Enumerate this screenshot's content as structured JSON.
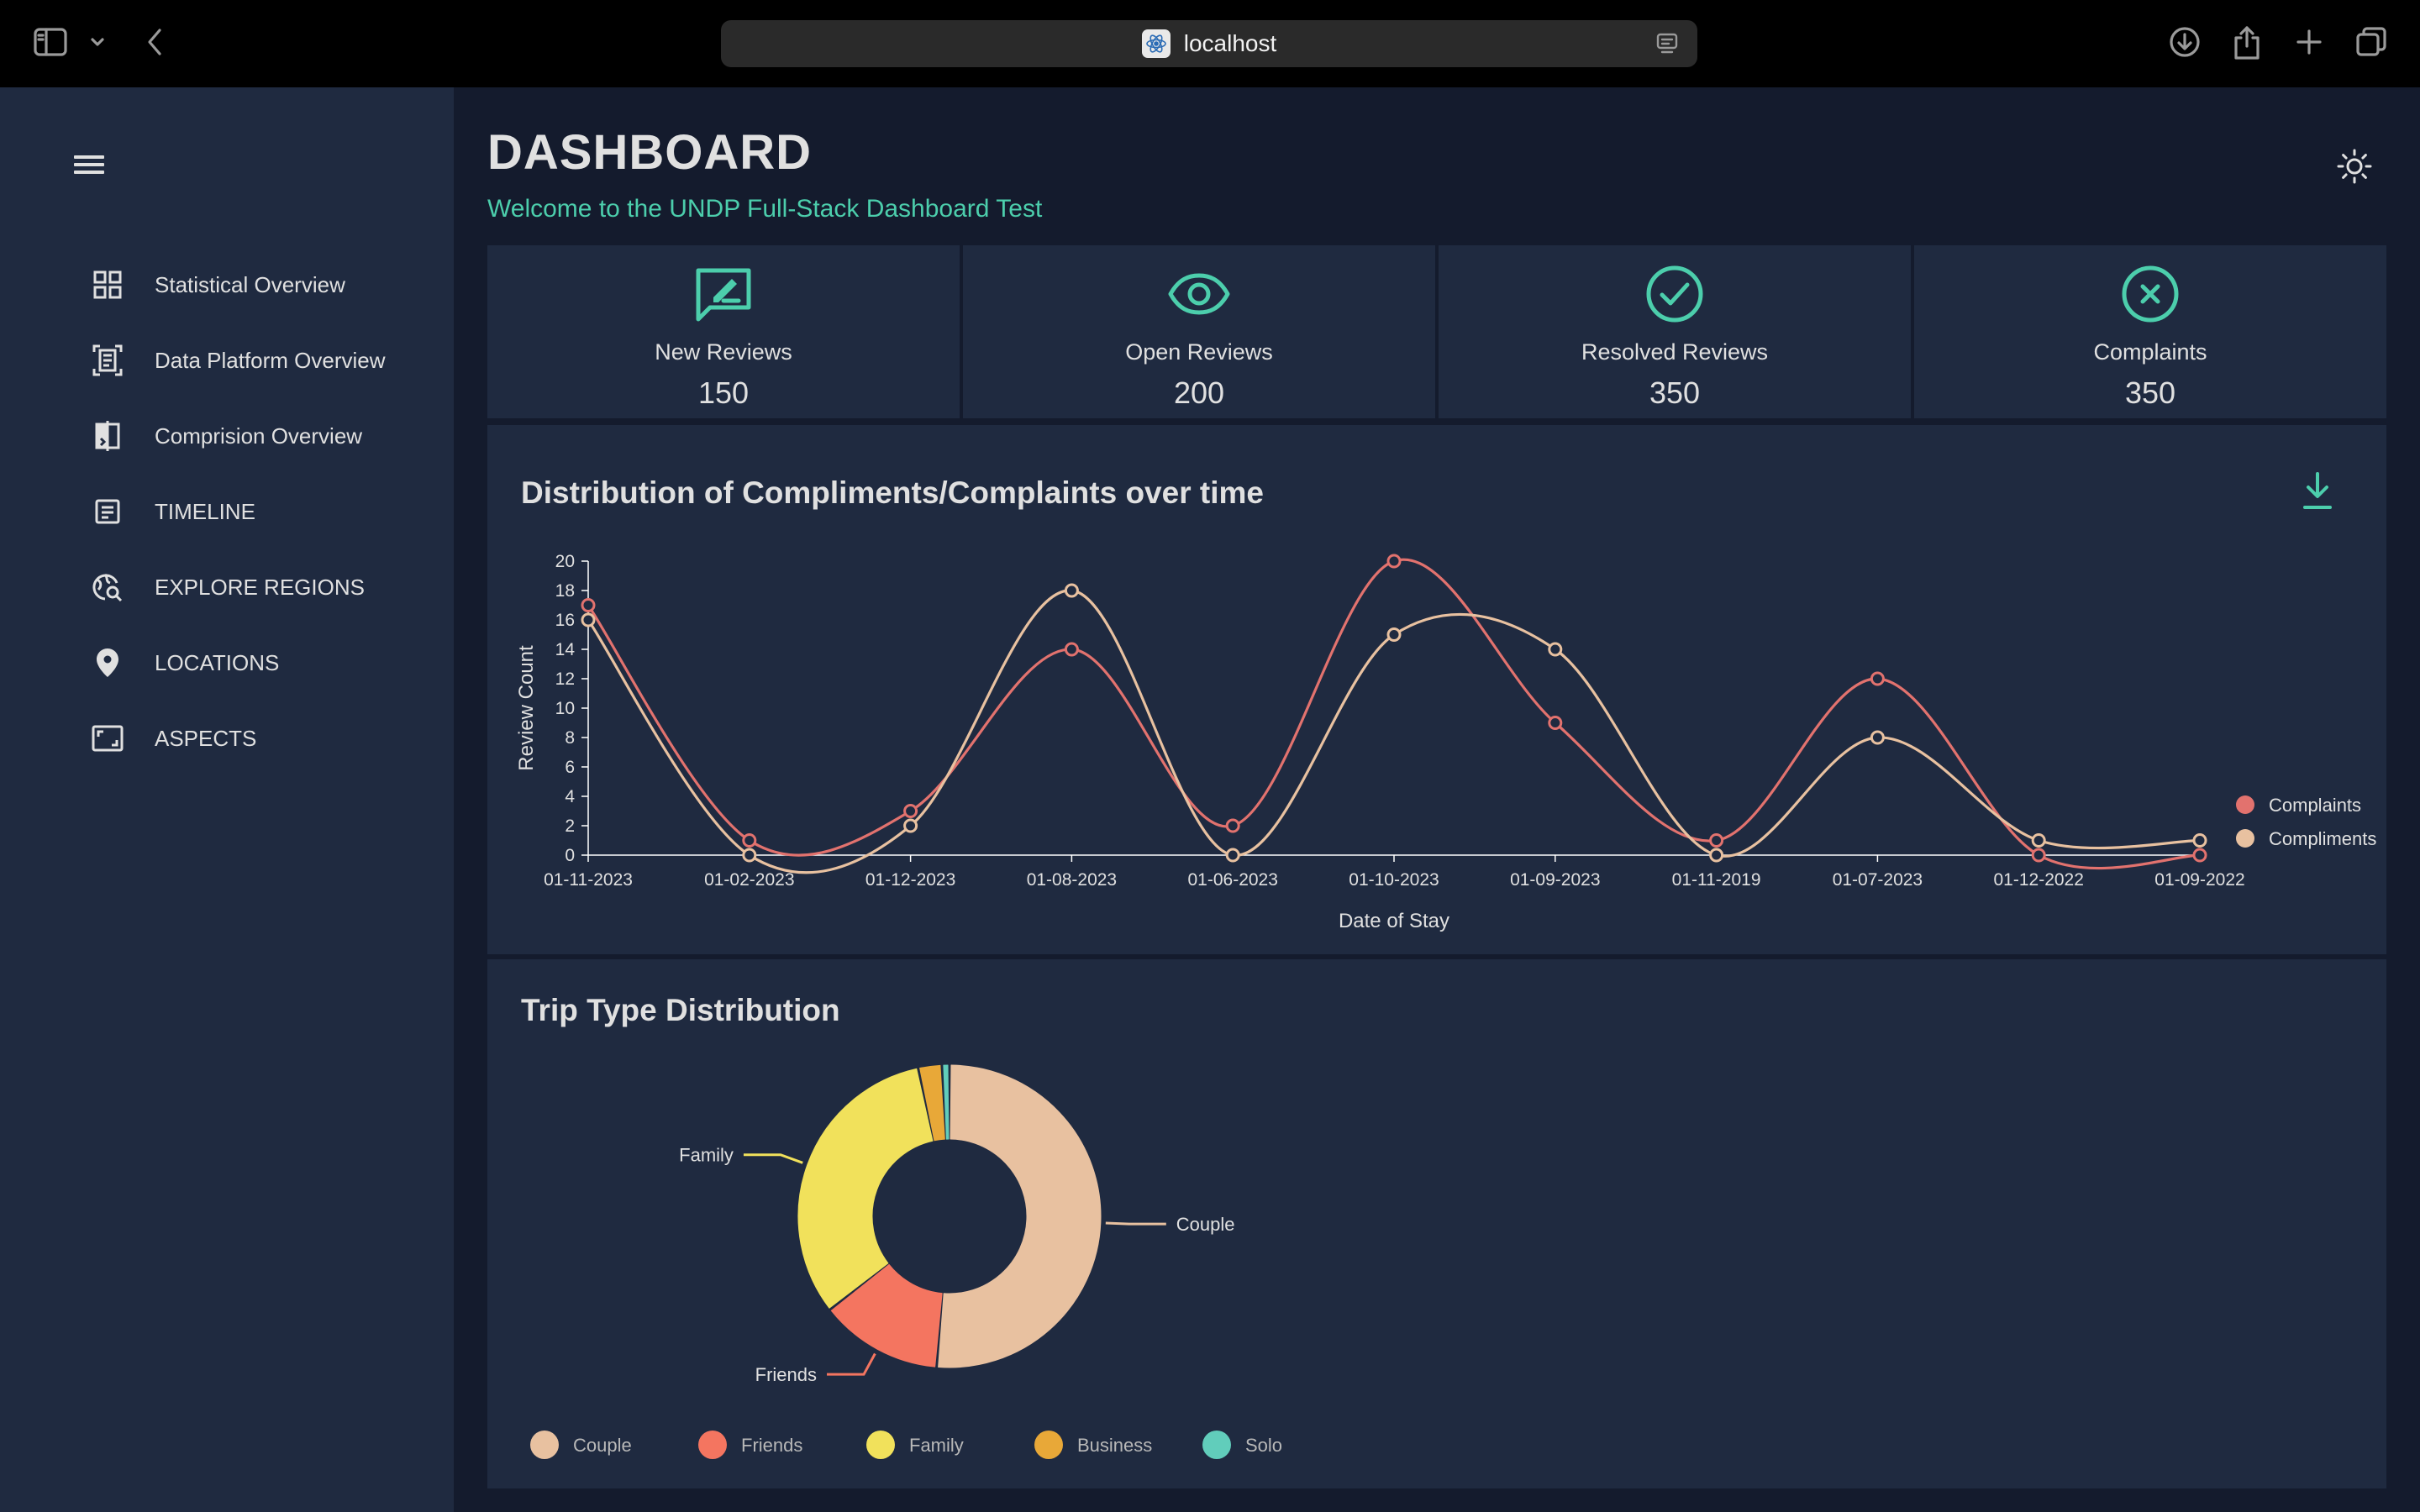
{
  "browser": {
    "url": "localhost"
  },
  "sidebar": {
    "items": [
      {
        "label": "Statistical Overview",
        "icon": "grid-icon"
      },
      {
        "label": "Data Platform Overview",
        "icon": "document-scan-icon"
      },
      {
        "label": "Comprision Overview",
        "icon": "compare-icon"
      },
      {
        "label": "TIMELINE",
        "icon": "timeline-icon"
      },
      {
        "label": "EXPLORE REGIONS",
        "icon": "travel-explore-icon"
      },
      {
        "label": "LOCATIONS",
        "icon": "location-pin-icon"
      },
      {
        "label": "ASPECTS",
        "icon": "aspect-ratio-icon"
      }
    ]
  },
  "header": {
    "title": "DASHBOARD",
    "subtitle": "Welcome to the UNDP Full-Stack Dashboard Test"
  },
  "stats": [
    {
      "label": "New Reviews",
      "value": "150",
      "icon": "rate-review-icon"
    },
    {
      "label": "Open Reviews",
      "value": "200",
      "icon": "eye-icon"
    },
    {
      "label": "Resolved Reviews",
      "value": "350",
      "icon": "check-circle-icon"
    },
    {
      "label": "Complaints",
      "value": "350",
      "icon": "cancel-circle-icon"
    }
  ],
  "colors": {
    "accent": "#4cceac",
    "complaints": "#e2726e",
    "compliments": "#e8c1a0",
    "couple": "#e8c1a0",
    "friends": "#f47560",
    "family": "#f1e15b",
    "business": "#e8a838",
    "solo": "#61cdbb"
  },
  "line_chart": {
    "title": "Distribution of Compliments/Complaints over time"
  },
  "pie_chart": {
    "title": "Trip Type Distribution"
  },
  "chart_data": [
    {
      "type": "line",
      "title": "Distribution of Compliments/Complaints over time",
      "xlabel": "Date of Stay",
      "ylabel": "Review Count",
      "x": [
        "01-11-2023",
        "01-02-2023",
        "01-12-2023",
        "01-08-2023",
        "01-06-2023",
        "01-10-2023",
        "01-09-2023",
        "01-11-2019",
        "01-07-2023",
        "01-12-2022",
        "01-09-2022"
      ],
      "ylim": [
        0,
        20
      ],
      "yticks": [
        0,
        2,
        4,
        6,
        8,
        10,
        12,
        14,
        16,
        18,
        20
      ],
      "series": [
        {
          "name": "Complaints",
          "values": [
            17,
            1,
            3,
            14,
            2,
            20,
            9,
            1,
            12,
            0,
            0
          ]
        },
        {
          "name": "Compliments",
          "values": [
            16,
            0,
            2,
            18,
            0,
            15,
            14,
            0,
            8,
            1,
            1
          ]
        }
      ],
      "legend_position": "right"
    },
    {
      "type": "pie",
      "title": "Trip Type Distribution",
      "donut": true,
      "slices": [
        {
          "label": "Couple",
          "value": 51
        },
        {
          "label": "Friends",
          "value": 13
        },
        {
          "label": "Family",
          "value": 32
        },
        {
          "label": "Business",
          "value": 2.5
        },
        {
          "label": "Solo",
          "value": 0.8
        }
      ],
      "slice_labels_shown": [
        "Couple",
        "Friends",
        "Family"
      ],
      "legend": [
        "Couple",
        "Friends",
        "Family",
        "Business",
        "Solo"
      ],
      "legend_position": "bottom"
    }
  ]
}
